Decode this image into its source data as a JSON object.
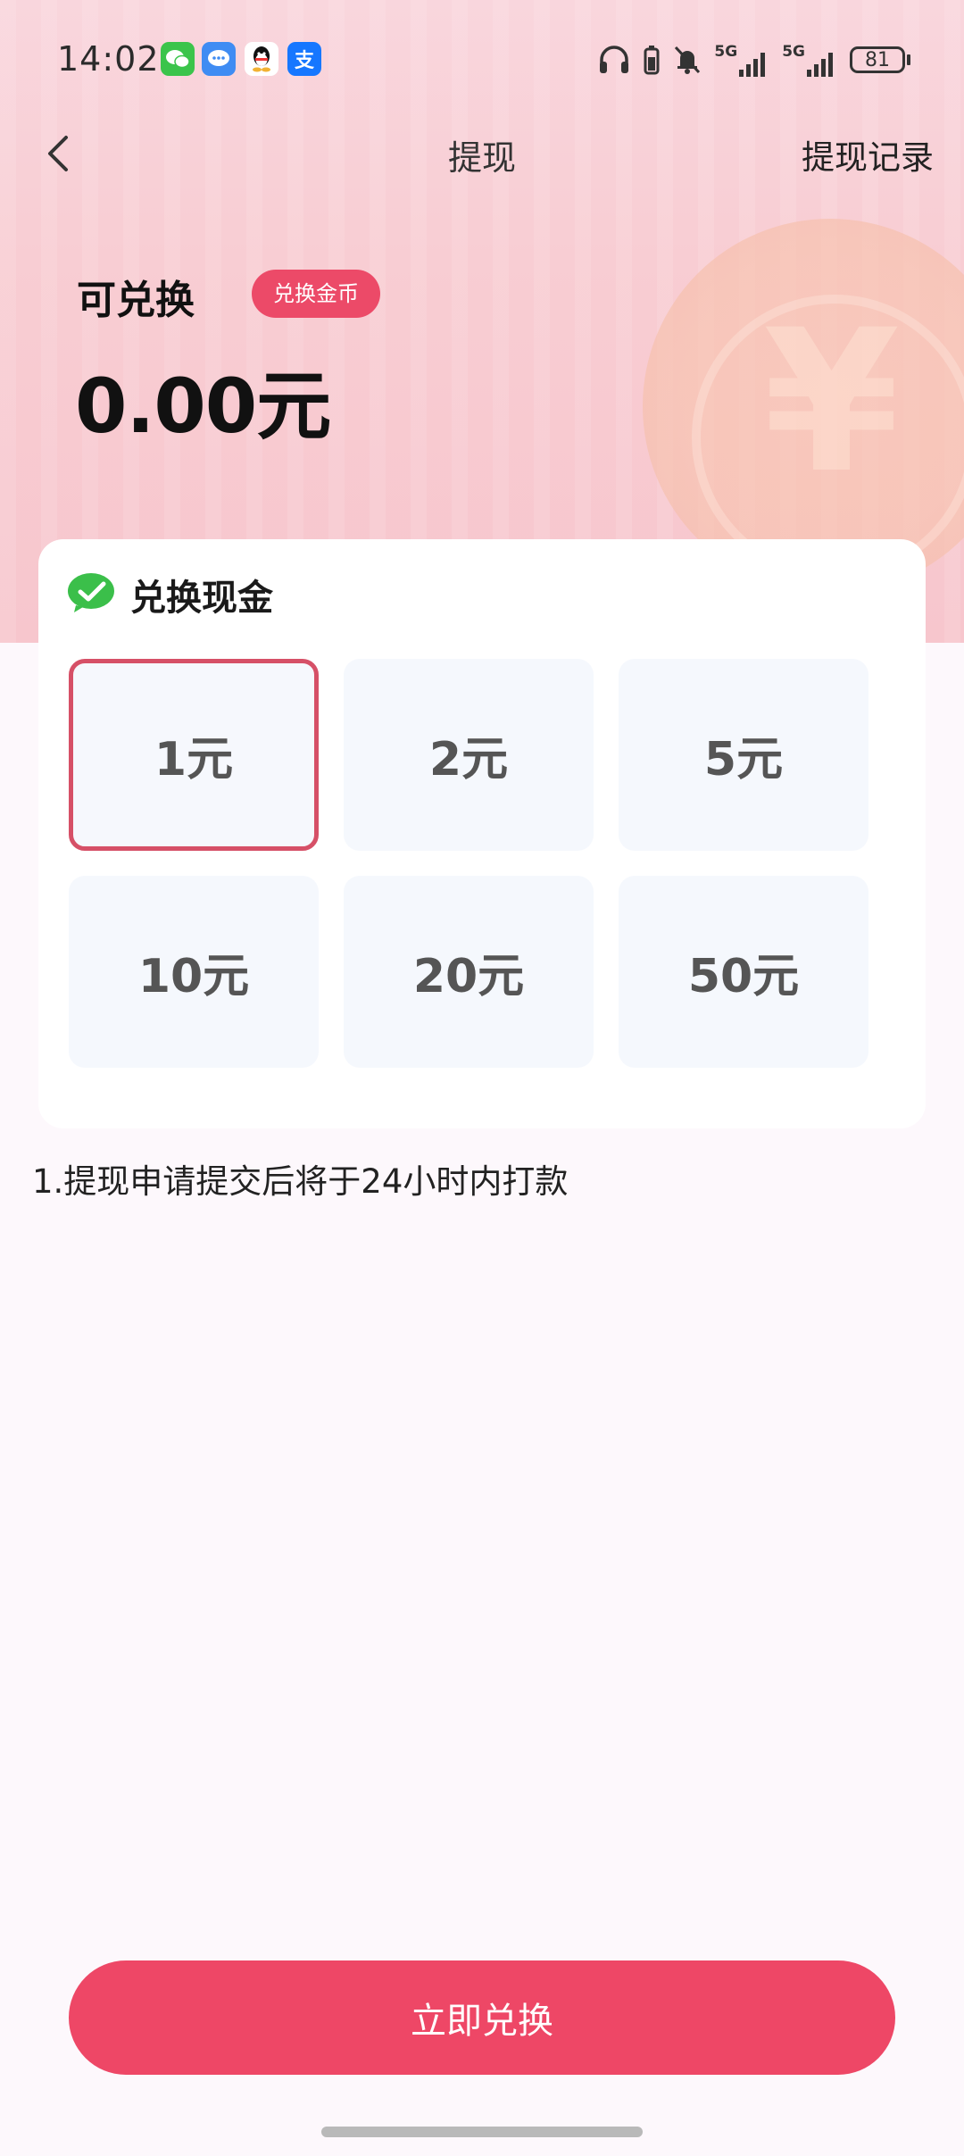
{
  "status_bar": {
    "time": "14:02",
    "apps": [
      "wechat-icon",
      "messages-icon",
      "qq-icon",
      "alipay-icon"
    ],
    "network": [
      "5G",
      "5G"
    ],
    "battery": "81"
  },
  "nav": {
    "title": "提现",
    "right_link": "提现记录"
  },
  "balance": {
    "label": "可兑换",
    "exchange_coins_label": "兑换金币",
    "amount": "0.00元"
  },
  "exchange_card": {
    "title": "兑换现金",
    "options": [
      "1元",
      "2元",
      "5元",
      "10元",
      "20元",
      "50元"
    ],
    "selected_index": 0
  },
  "note": "1.提现申请提交后将于24小时内打款",
  "cta_label": "立即兑换",
  "colors": {
    "accent": "#ee4766",
    "selected_border": "#d65067",
    "option_bg": "#f5f8fd",
    "wechat_green": "#3bbf4a"
  }
}
